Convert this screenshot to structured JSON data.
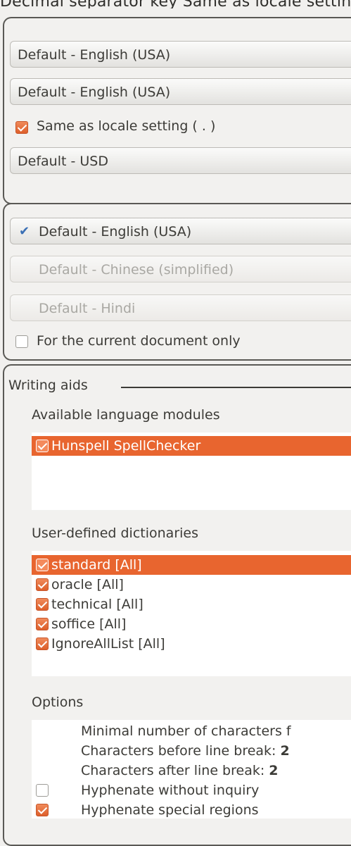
{
  "top_cut_text": "Decimal separator key Same as locale setting",
  "locale": {
    "locale_setting": "Default - English (USA)",
    "ui_language": "Default - English (USA)",
    "same_as_locale_label": "Same as locale setting ( . )",
    "same_as_locale_checked": true,
    "default_currency": "Default - USD"
  },
  "doc_languages": {
    "western": "Default - English (USA)",
    "asian": "Default - Chinese (simplified)",
    "ctl": "Default - Hindi",
    "current_doc_only_label": "For the current document only",
    "current_doc_only_checked": false
  },
  "writing_aids": {
    "title": "Writing aids",
    "modules_label": "Available language modules",
    "modules": [
      {
        "name": "Hunspell SpellChecker",
        "checked": true,
        "selected": true
      }
    ],
    "dictionaries_label": "User-defined dictionaries",
    "dictionaries": [
      {
        "name": "standard [All]",
        "checked": true,
        "selected": true
      },
      {
        "name": "oracle [All]",
        "checked": true,
        "selected": false
      },
      {
        "name": "technical [All]",
        "checked": true,
        "selected": false
      },
      {
        "name": "soffice [All]",
        "checked": true,
        "selected": false
      },
      {
        "name": "IgnoreAllList [All]",
        "checked": true,
        "selected": false
      }
    ],
    "options_label": "Options",
    "options": [
      {
        "label": "Minimal number of characters f",
        "value": "",
        "checkbox": null
      },
      {
        "label": "Characters before line break:",
        "value": "2",
        "checkbox": null
      },
      {
        "label": "Characters after line break:",
        "value": "2",
        "checkbox": null
      },
      {
        "label": "Hyphenate without inquiry",
        "value": "",
        "checkbox": false
      },
      {
        "label": "Hyphenate special regions",
        "value": "",
        "checkbox": true
      }
    ]
  },
  "colors": {
    "accent": "#e8652f",
    "window_bg": "#f1f0ee"
  }
}
